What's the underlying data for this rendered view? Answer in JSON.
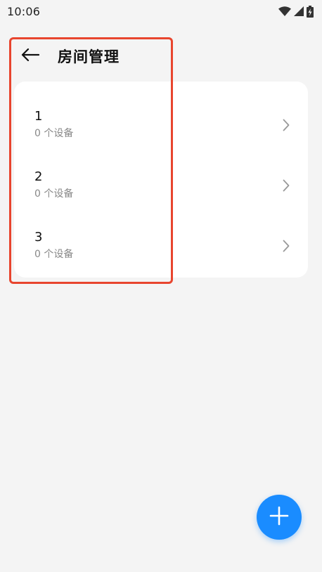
{
  "status_bar": {
    "time": "10:06",
    "icons": [
      "wifi-icon",
      "signal-icon",
      "battery-charging-icon"
    ]
  },
  "header": {
    "back_icon": "arrow-left-icon",
    "title": "房间管理"
  },
  "rooms": [
    {
      "name": "1",
      "device_count": "0 个设备"
    },
    {
      "name": "2",
      "device_count": "0 个设备"
    },
    {
      "name": "3",
      "device_count": "0 个设备"
    }
  ],
  "fab": {
    "icon": "plus-icon"
  },
  "colors": {
    "background": "#f4f4f4",
    "card": "#ffffff",
    "accent": "#1a8cff",
    "highlight": "#e8452e",
    "secondary_text": "#888888"
  }
}
